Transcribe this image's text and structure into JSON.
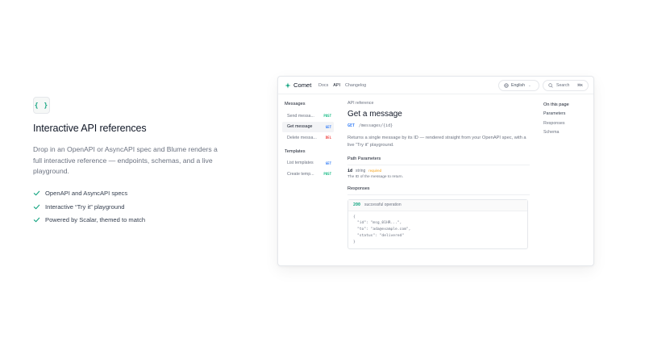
{
  "feature": {
    "icon_text": "{ }",
    "title": "Interactive API references",
    "description": "Drop in an OpenAPI or AsyncAPI spec and Blume renders a full interactive reference — endpoints, schemas, and a live playground.",
    "checklist": [
      "OpenAPI and AsyncAPI specs",
      "Interactive “Try it” playground",
      "Powered by Scalar, themed to match"
    ]
  },
  "window": {
    "brand": "Comet",
    "nav": [
      "Docs",
      "API",
      "Changelog"
    ],
    "language": "English",
    "search_placeholder": "Search",
    "search_shortcut": "⌘K",
    "sidebar": {
      "sections": [
        {
          "title": "Messages",
          "items": [
            {
              "label": "Send messa...",
              "method": "POST"
            },
            {
              "label": "Get message",
              "method": "GET"
            },
            {
              "label": "Delete messa...",
              "method": "DEL"
            }
          ]
        },
        {
          "title": "Templates",
          "items": [
            {
              "label": "List templates",
              "method": "GET"
            },
            {
              "label": "Create temp...",
              "method": "POST"
            }
          ]
        }
      ]
    },
    "main": {
      "breadcrumb": "API reference",
      "title": "Get a message",
      "method": "GET",
      "path": "/messages/{id}",
      "description": "Returns a single message by its ID — rendered straight from your OpenAPI spec, with a live “Try it” playground.",
      "path_params_title": "Path Parameters",
      "param_name": "id",
      "param_type": "string",
      "param_required": "required",
      "param_desc": "The ID of the message to return.",
      "responses_title": "Responses",
      "response_code": "200",
      "response_desc": "successful operation",
      "response_lines": [
        "{",
        "\"id\": \"msg_01HR...\",",
        "\"to\": \"ada@example.com\",",
        "\"status\": \"delivered\"",
        "}"
      ]
    },
    "toc": {
      "title": "On this page",
      "items": [
        "Parameters",
        "Responses",
        "Schema"
      ]
    }
  },
  "colors": {
    "accent": "#10a37f",
    "get": "#3b82f6",
    "post": "#10b981",
    "del": "#ef4444",
    "required": "#f59e0b"
  }
}
